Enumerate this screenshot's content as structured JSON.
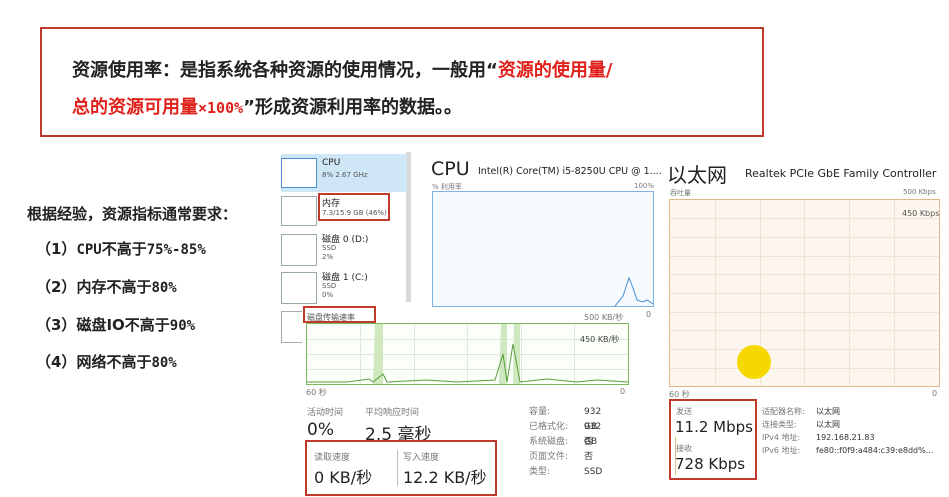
{
  "definition": {
    "line1_prefix": "资源使用率：是指系统各种资源的使用情况，一般用“",
    "line1_highlight": "资源的使用量/",
    "line2_highlight": "总的资源可用量",
    "line2_mono": "×100%",
    "line2_suffix": "”形成资源利用率的数据。。"
  },
  "requirements": {
    "heading": "根据经验，资源指标通常要求：",
    "items": [
      {
        "num": "（1）",
        "mono": "CPU",
        "text": "不高于",
        "value": "75%-85%"
      },
      {
        "num": "（2）",
        "mono": "",
        "text": "内存不高于",
        "value": "80%"
      },
      {
        "num": "（3）",
        "mono": "",
        "text": "磁盘IO不高于",
        "value": "90%"
      },
      {
        "num": "（4）",
        "mono": "",
        "text": "网络不高于",
        "value": "80%"
      }
    ]
  },
  "sidebar": {
    "items": [
      {
        "title": "CPU",
        "sub1": "8% 2.67 GHz",
        "sub2": "",
        "sub3": ""
      },
      {
        "title": "内存",
        "sub1": "7.3/15.9 GB (46%)",
        "sub2": "",
        "sub3": ""
      },
      {
        "title": "磁盘 0 (D:)",
        "sub1": "SSD",
        "sub2": "2%",
        "sub3": ""
      },
      {
        "title": "磁盘 1 (C:)",
        "sub1": "SSD",
        "sub2": "0%",
        "sub3": ""
      }
    ]
  },
  "cpu": {
    "title": "CPU",
    "model": "Intel(R) Core(TM) i5-8250U CPU @ 1....",
    "axis_left": "% 利用率",
    "axis_right": "100%"
  },
  "disk": {
    "transfer_label": "磁盘传输速率",
    "max_label": "500 KB/秒",
    "mid_label": "450 KB/秒",
    "time_label": "60 秒",
    "zero_label": "0",
    "side_zero": "0",
    "active_time_label": "活动时间",
    "active_time_value": "0%",
    "response_label": "平均响应时间",
    "response_value": "2.5 毫秒",
    "read_label": "读取速度",
    "read_value": "0 KB/秒",
    "write_label": "写入速度",
    "write_value": "12.2 KB/秒",
    "props": [
      {
        "k": "容量:",
        "v": "932 GB"
      },
      {
        "k": "已格式化:",
        "v": "932 GB"
      },
      {
        "k": "系统磁盘:",
        "v": "否"
      },
      {
        "k": "页面文件:",
        "v": "否"
      },
      {
        "k": "类型:",
        "v": "SSD"
      }
    ]
  },
  "ethernet": {
    "title": "以太网",
    "adapter": "Realtek PCIe GbE Family Controller",
    "throughput_label": "吞吐量",
    "max_label": "500 Kbps",
    "mid_label": "450 Kbps",
    "time_label": "60 秒",
    "zero_label": "0",
    "send_label": "发送",
    "send_value": "11.2 Mbps",
    "recv_label": "接收",
    "recv_value": "728 Kbps",
    "props": [
      {
        "k": "适配器名称:",
        "v": "以太网"
      },
      {
        "k": "连接类型:",
        "v": "以太网"
      },
      {
        "k": "IPv4 地址:",
        "v": "192.168.21.83"
      },
      {
        "k": "IPv6 地址:",
        "v": "fe80::f0f9:a484:c39:e8dd%..."
      }
    ]
  },
  "colors": {
    "accent_red": "#e0201a",
    "box_red": "#c0392b",
    "disk_green": "#5a9e3f",
    "cpu_blue": "#4a8fd0",
    "cursor_yellow": "#f5d800"
  }
}
